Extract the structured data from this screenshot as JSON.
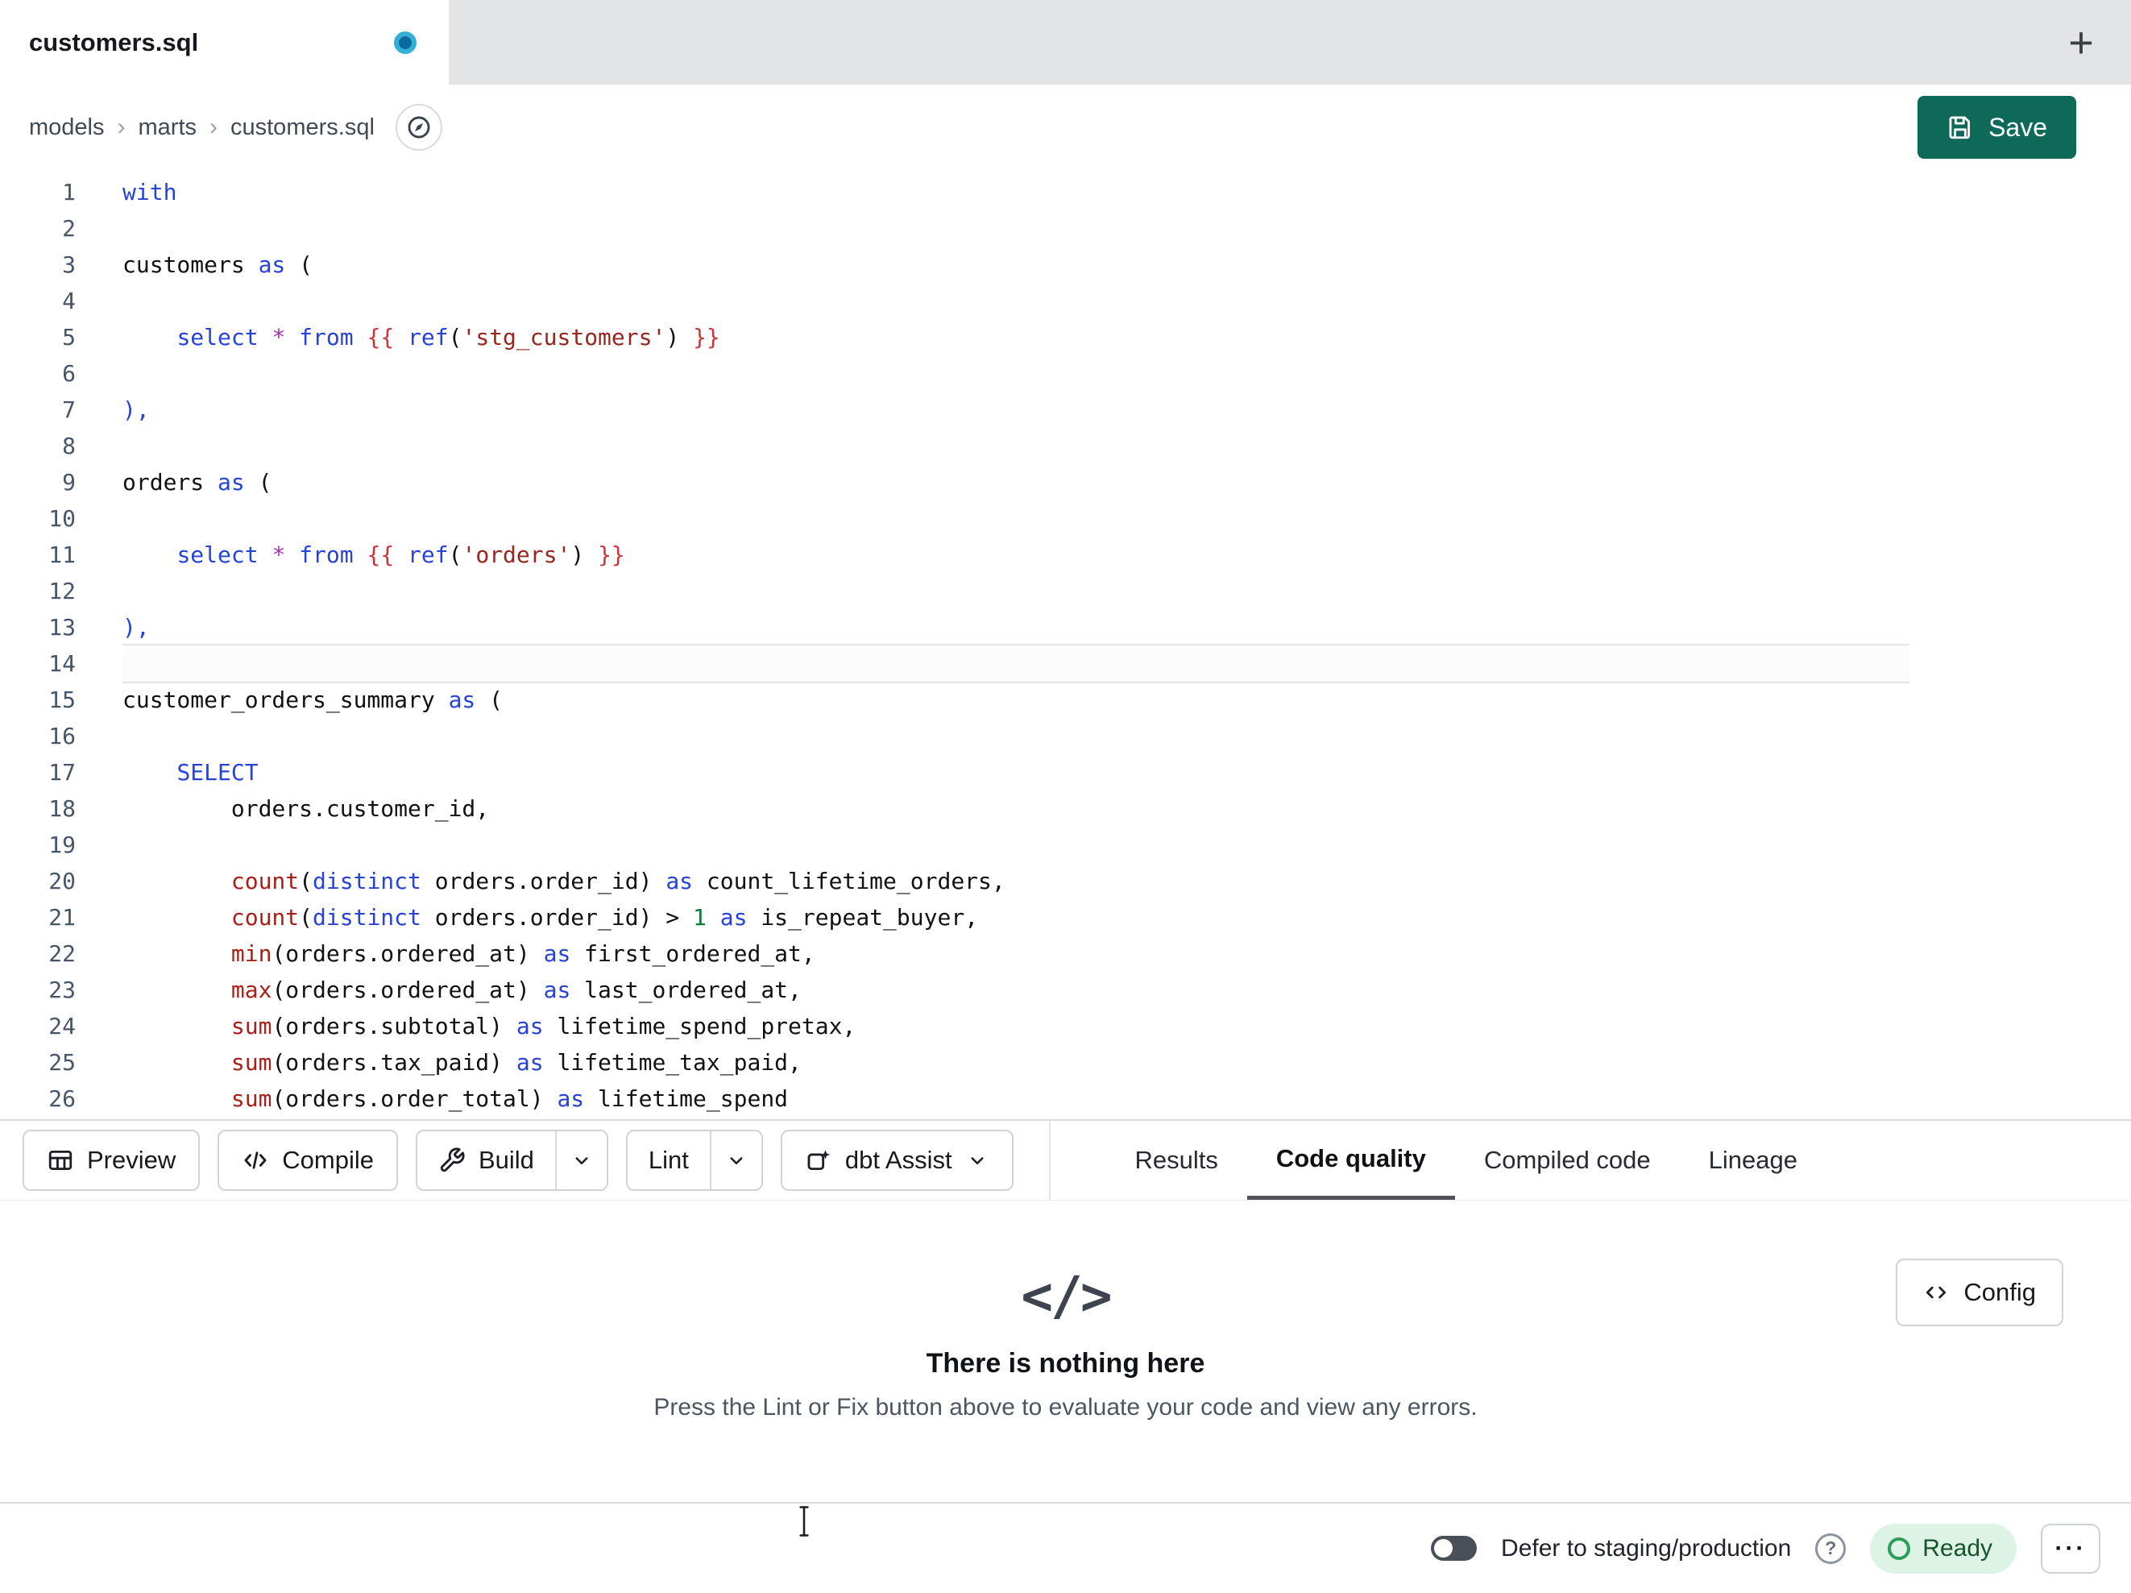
{
  "tab_bar": {
    "tab_title": "customers.sql",
    "new_tab": "+"
  },
  "breadcrumb": {
    "items": [
      "models",
      "marts",
      "customers.sql"
    ],
    "separator": "›"
  },
  "save_label": "Save",
  "editor": {
    "active_line": 14,
    "palette": {
      "kw": "#2743d6",
      "fn": "#a8201a",
      "st": "#96261f",
      "br": "#cf3338",
      "op": "#a832a8",
      "nu": "#0e7a3e",
      "pa": "#2743d6",
      "pl": "#111111"
    },
    "lines": [
      [
        [
          "with",
          "kw"
        ]
      ],
      [],
      [
        [
          "customers ",
          "pl"
        ],
        [
          "as",
          "kw"
        ],
        [
          " (",
          "pl"
        ]
      ],
      [],
      [
        [
          "    ",
          "pl"
        ],
        [
          "select",
          "kw"
        ],
        [
          " ",
          "pl"
        ],
        [
          "*",
          "op"
        ],
        [
          " ",
          "pl"
        ],
        [
          "from",
          "kw"
        ],
        [
          " ",
          "pl"
        ],
        [
          "{{",
          "br"
        ],
        [
          " ",
          "pl"
        ],
        [
          "ref",
          "kw"
        ],
        [
          "(",
          "pl"
        ],
        [
          "'stg_customers'",
          "st"
        ],
        [
          ")",
          "pl"
        ],
        [
          " ",
          "pl"
        ],
        [
          "}}",
          "br"
        ]
      ],
      [],
      [
        [
          "),",
          "pa"
        ]
      ],
      [],
      [
        [
          "orders ",
          "pl"
        ],
        [
          "as",
          "kw"
        ],
        [
          " (",
          "pl"
        ]
      ],
      [],
      [
        [
          "    ",
          "pl"
        ],
        [
          "select",
          "kw"
        ],
        [
          " ",
          "pl"
        ],
        [
          "*",
          "op"
        ],
        [
          " ",
          "pl"
        ],
        [
          "from",
          "kw"
        ],
        [
          " ",
          "pl"
        ],
        [
          "{{",
          "br"
        ],
        [
          " ",
          "pl"
        ],
        [
          "ref",
          "kw"
        ],
        [
          "(",
          "pl"
        ],
        [
          "'orders'",
          "st"
        ],
        [
          ")",
          "pl"
        ],
        [
          " ",
          "pl"
        ],
        [
          "}}",
          "br"
        ]
      ],
      [],
      [
        [
          "),",
          "pa"
        ]
      ],
      [],
      [
        [
          "customer_orders_summary ",
          "pl"
        ],
        [
          "as",
          "kw"
        ],
        [
          " (",
          "pl"
        ]
      ],
      [],
      [
        [
          "    ",
          "pl"
        ],
        [
          "SELECT",
          "kw"
        ]
      ],
      [
        [
          "        orders.customer_id,",
          "pl"
        ]
      ],
      [],
      [
        [
          "        ",
          "pl"
        ],
        [
          "count",
          "fn"
        ],
        [
          "(",
          "pl"
        ],
        [
          "distinct",
          "kw"
        ],
        [
          " orders.order_id",
          "pl"
        ],
        [
          ") ",
          "pl"
        ],
        [
          "as",
          "kw"
        ],
        [
          " count_lifetime_orders,",
          "pl"
        ]
      ],
      [
        [
          "        ",
          "pl"
        ],
        [
          "count",
          "fn"
        ],
        [
          "(",
          "pl"
        ],
        [
          "distinct",
          "kw"
        ],
        [
          " orders.order_id",
          "pl"
        ],
        [
          ") > ",
          "pl"
        ],
        [
          "1",
          "nu"
        ],
        [
          " ",
          "pl"
        ],
        [
          "as",
          "kw"
        ],
        [
          " is_repeat_buyer,",
          "pl"
        ]
      ],
      [
        [
          "        ",
          "pl"
        ],
        [
          "min",
          "fn"
        ],
        [
          "(orders.ordered_at) ",
          "pl"
        ],
        [
          "as",
          "kw"
        ],
        [
          " first_ordered_at,",
          "pl"
        ]
      ],
      [
        [
          "        ",
          "pl"
        ],
        [
          "max",
          "fn"
        ],
        [
          "(orders.ordered_at) ",
          "pl"
        ],
        [
          "as",
          "kw"
        ],
        [
          " last_ordered_at,",
          "pl"
        ]
      ],
      [
        [
          "        ",
          "pl"
        ],
        [
          "sum",
          "fn"
        ],
        [
          "(orders.subtotal) ",
          "pl"
        ],
        [
          "as",
          "kw"
        ],
        [
          " lifetime_spend_pretax,",
          "pl"
        ]
      ],
      [
        [
          "        ",
          "pl"
        ],
        [
          "sum",
          "fn"
        ],
        [
          "(orders.tax_paid) ",
          "pl"
        ],
        [
          "as",
          "kw"
        ],
        [
          " lifetime_tax_paid,",
          "pl"
        ]
      ],
      [
        [
          "        ",
          "pl"
        ],
        [
          "sum",
          "fn"
        ],
        [
          "(orders.order_total) ",
          "pl"
        ],
        [
          "as",
          "kw"
        ],
        [
          " lifetime_spend",
          "pl"
        ]
      ]
    ],
    "minimap_extra": [
      46,
      40,
      38,
      0,
      34,
      0,
      2,
      0,
      24,
      28,
      26,
      0,
      30,
      2,
      0
    ]
  },
  "toolbar": {
    "preview": "Preview",
    "compile": "Compile",
    "build": "Build",
    "lint": "Lint",
    "assist": "dbt Assist"
  },
  "result_tabs": [
    {
      "label": "Results"
    },
    {
      "label": "Code quality"
    },
    {
      "label": "Compiled code"
    },
    {
      "label": "Lineage"
    }
  ],
  "results_panel": {
    "config": "Config",
    "empty_icon": "</>",
    "empty_title": "There is nothing here",
    "empty_subtitle": "Press the Lint or Fix button above to evaluate your code and view any errors."
  },
  "status_bar": {
    "defer_label": "Defer to staging/production",
    "help_glyph": "?",
    "ready": "Ready",
    "more_glyph": "···"
  },
  "colors": {
    "save_button": "#0e6958",
    "unsaved_dot": "#35aed8",
    "active_tab_underline": "#4f525a",
    "ready_text": "#14532d",
    "ready_bg": "#dcf3e6"
  }
}
